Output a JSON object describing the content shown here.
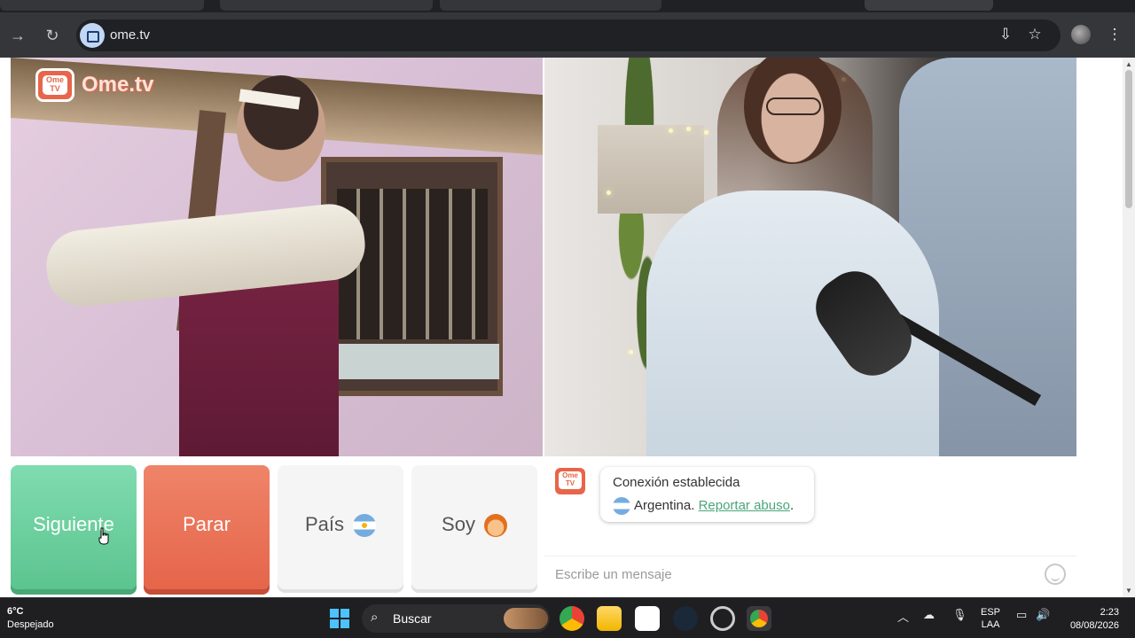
{
  "browser": {
    "url": "ome.tv"
  },
  "logo": {
    "tv_text": "Ome\nTV",
    "text": "Ome.tv"
  },
  "controls": {
    "next_label": "Siguiente",
    "stop_label": "Parar",
    "country_label": "País",
    "me_label": "Soy"
  },
  "chat": {
    "status_line": "Conexión establecida",
    "country": "Argentina.",
    "report_link": "Reportar abuso",
    "report_suffix": ".",
    "input_placeholder": "Escribe un mensaje"
  },
  "taskbar": {
    "temperature": "6°C",
    "weather": "Despejado",
    "search_label": "Buscar",
    "lang_top": "ESP",
    "lang_bottom": "LAA",
    "time": "2:23",
    "date": "08/08/2026"
  },
  "colors": {
    "brand": "#e8654a",
    "next_green": "#6fd3a3",
    "stop_red": "#e96f53",
    "link_green": "#4aa57b"
  }
}
